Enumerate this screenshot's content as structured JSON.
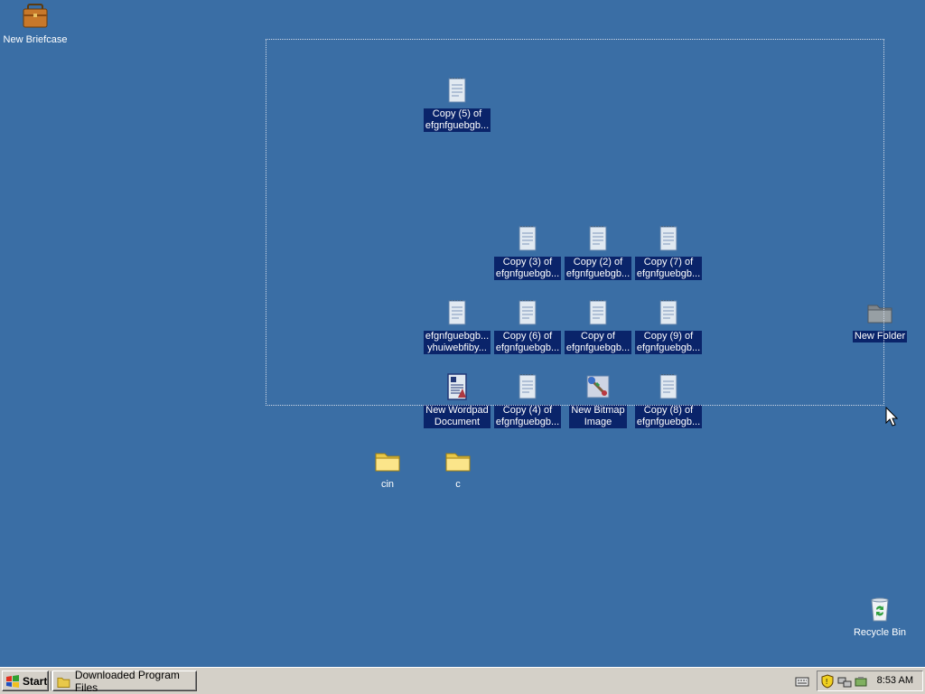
{
  "desktop": {
    "icons": {
      "briefcase": "New Briefcase",
      "copy5_l1": "Copy (5) of",
      "copy5_l2": "efgnfguebgb...",
      "copy3_l1": "Copy (3) of",
      "copy3_l2": "efgnfguebgb...",
      "copy2_l1": "Copy (2) of",
      "copy2_l2": "efgnfguebgb...",
      "copy7_l1": "Copy (7) of",
      "copy7_l2": "efgnfguebgb...",
      "efg_l1": "efgnfguebgb...",
      "efg_l2": "yhuiwebfiby...",
      "copy6_l1": "Copy (6) of",
      "copy6_l2": "efgnfguebgb...",
      "copy_l1": "Copy of",
      "copy_l2": "efgnfguebgb...",
      "copy9_l1": "Copy (9) of",
      "copy9_l2": "efgnfguebgb...",
      "wordpad_l1": "New Wordpad",
      "wordpad_l2": "Document",
      "copy4_l1": "Copy (4) of",
      "copy4_l2": "efgnfguebgb...",
      "bitmap_l1": "New Bitmap",
      "bitmap_l2": "Image",
      "copy8_l1": "Copy (8) of",
      "copy8_l2": "efgnfguebgb...",
      "new_folder": "New Folder",
      "cin": "cin",
      "c": "c",
      "recycle": "Recycle Bin"
    }
  },
  "taskbar": {
    "start_label": "Start",
    "task_label": "Downloaded Program Files",
    "clock": "8:53 AM"
  },
  "colors": {
    "desktop": "#3a6ea5",
    "selection": "#0a246a",
    "taskbar": "#d4d0c8"
  }
}
